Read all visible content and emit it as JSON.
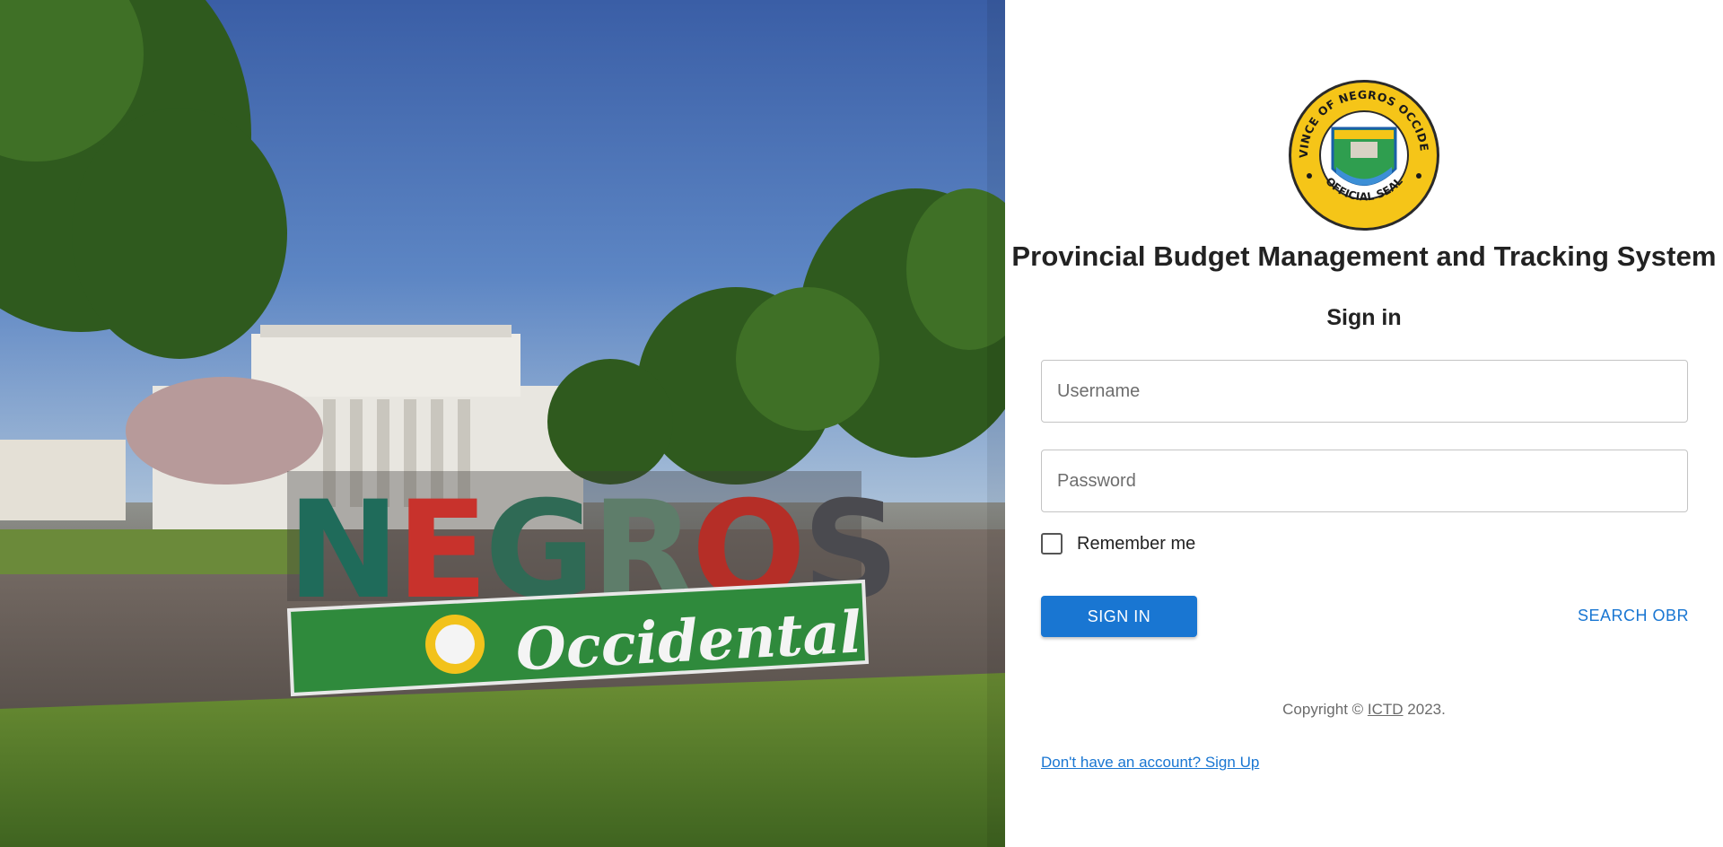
{
  "hero": {
    "sign_word": "NEGROS",
    "sign_subtitle": "Occidental"
  },
  "seal": {
    "ring_text_top": "PROVINCE OF NEGROS OCCIDENTAL",
    "ring_text_bottom": "OFFICIAL SEAL",
    "ring_color": "#f5c518"
  },
  "app": {
    "title": "Provincial Budget Management and Tracking System"
  },
  "form": {
    "heading": "Sign in",
    "username_placeholder": "Username",
    "username_value": "",
    "password_placeholder": "Password",
    "password_value": "",
    "remember_label": "Remember me",
    "remember_checked": false,
    "signin_label": "SIGN IN",
    "search_obr_label": "SEARCH OBR"
  },
  "footer": {
    "copyright_prefix": "Copyright © ",
    "copyright_link": "ICTD",
    "copyright_suffix": " 2023.",
    "signup_link": "Don't have an account? Sign Up"
  },
  "colors": {
    "primary": "#1976d2",
    "text": "#222222",
    "muted": "#6b6b6b"
  }
}
